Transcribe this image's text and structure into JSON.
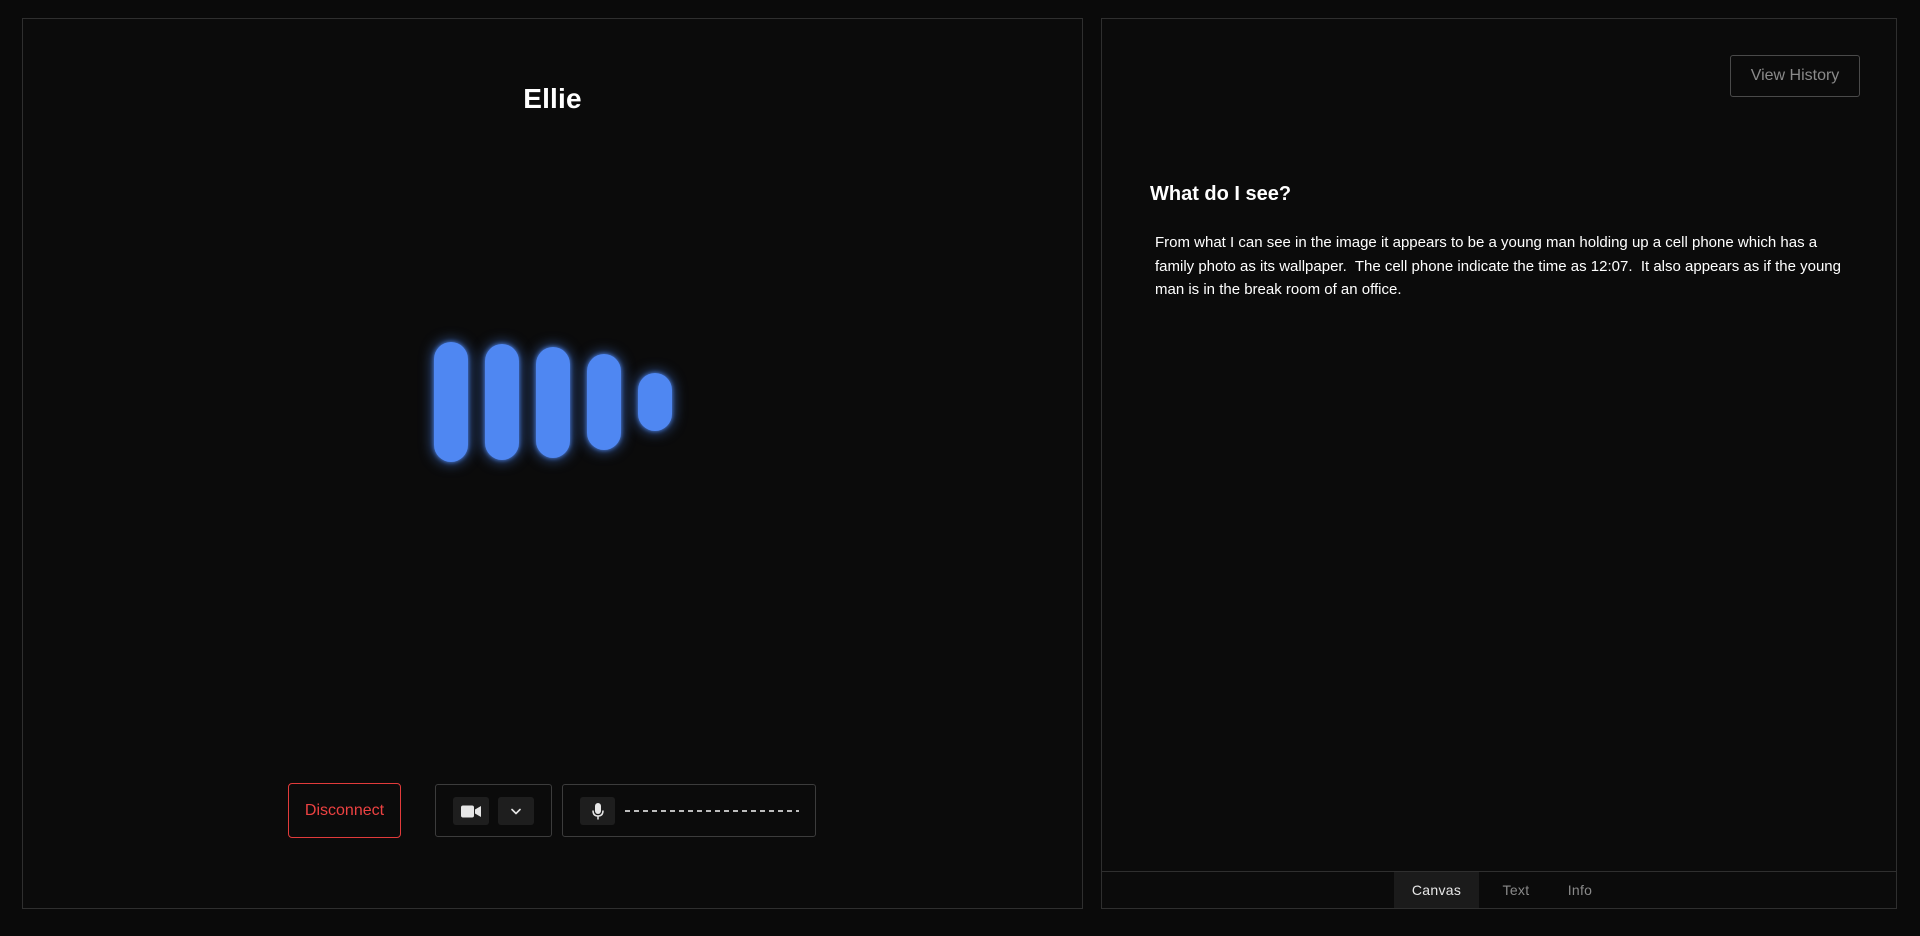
{
  "agent": {
    "name": "Ellie",
    "visualizer_levels": [
      1.0,
      0.95,
      0.9,
      0.72,
      0.28
    ]
  },
  "controls": {
    "disconnect_label": "Disconnect",
    "camera_icon": "video-camera-icon",
    "camera_menu_icon": "chevron-down-icon",
    "mic_icon": "microphone-icon"
  },
  "right": {
    "history_label": "View History",
    "heading": "What do I see?",
    "body": "From what I can see in the image it appears to be a young man holding up a cell phone which has a family photo as its wallpaper.  The cell phone indicate the time as 12:07.  It also appears as if the young man is in the break room of an office.",
    "tabs": [
      {
        "label": "Canvas",
        "active": true
      },
      {
        "label": "Text",
        "active": false
      },
      {
        "label": "Info",
        "active": false
      }
    ]
  },
  "colors": {
    "accent": "#4f87f2",
    "danger": "#ec4242",
    "background": "#0a0a0a"
  }
}
